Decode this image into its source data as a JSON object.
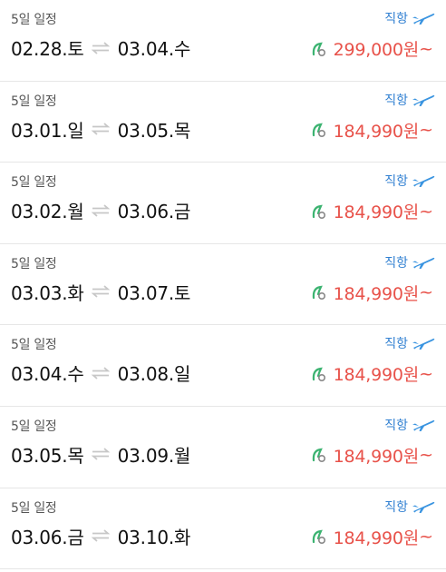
{
  "colors": {
    "price": "#e8524a",
    "direct": "#2f7fd1",
    "plane": "#3a94e0",
    "leaf": "#3cb371",
    "swap": "#c7c7c7",
    "divider": "#e6e6e6"
  },
  "icons": {
    "plane": "airplane-icon",
    "swap": "swap-arrows-icon",
    "leaf": "eco-leaf-icon"
  },
  "results": [
    {
      "duration": "5일 일정",
      "direct": "직항",
      "depart": "02.28.토",
      "return": "03.04.수",
      "price": "299,000원",
      "suffix": "~"
    },
    {
      "duration": "5일 일정",
      "direct": "직항",
      "depart": "03.01.일",
      "return": "03.05.목",
      "price": "184,990원",
      "suffix": "~"
    },
    {
      "duration": "5일 일정",
      "direct": "직항",
      "depart": "03.02.월",
      "return": "03.06.금",
      "price": "184,990원",
      "suffix": "~"
    },
    {
      "duration": "5일 일정",
      "direct": "직항",
      "depart": "03.03.화",
      "return": "03.07.토",
      "price": "184,990원",
      "suffix": "~"
    },
    {
      "duration": "5일 일정",
      "direct": "직항",
      "depart": "03.04.수",
      "return": "03.08.일",
      "price": "184,990원",
      "suffix": "~"
    },
    {
      "duration": "5일 일정",
      "direct": "직항",
      "depart": "03.05.목",
      "return": "03.09.월",
      "price": "184,990원",
      "suffix": "~"
    },
    {
      "duration": "5일 일정",
      "direct": "직항",
      "depart": "03.06.금",
      "return": "03.10.화",
      "price": "184,990원",
      "suffix": "~"
    }
  ]
}
